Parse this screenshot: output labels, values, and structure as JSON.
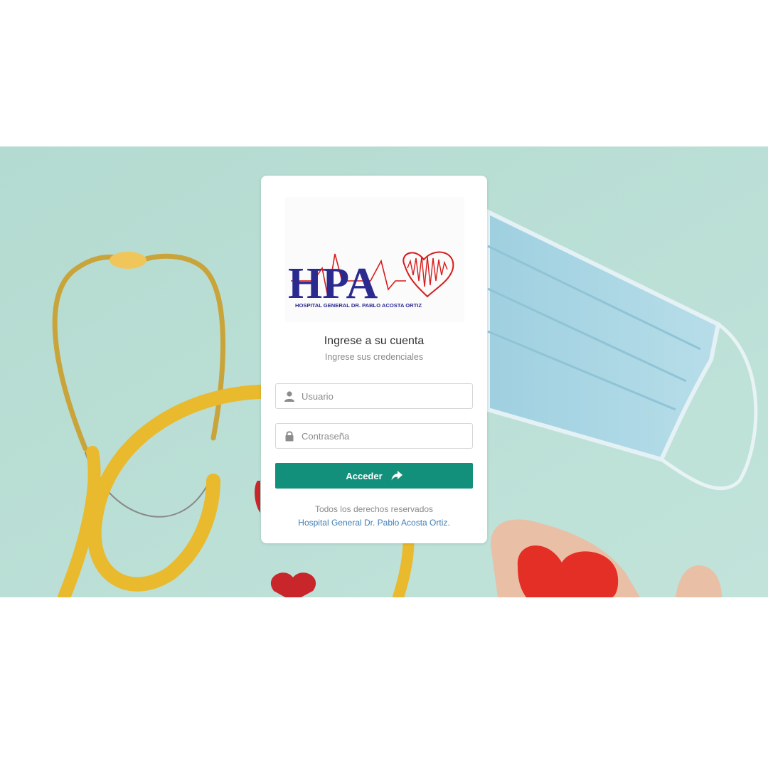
{
  "login": {
    "logo": {
      "letters": "HPA",
      "hospital_name": "HOSPITAL GENERAL DR. PABLO ACOSTA ORTIZ"
    },
    "title": "Ingrese a su cuenta",
    "subtitle": "Ingrese sus credenciales",
    "username": {
      "value": "",
      "placeholder": "Usuario",
      "icon": "user-icon"
    },
    "password": {
      "value": "",
      "placeholder": "Contraseña",
      "icon": "lock-icon"
    },
    "submit": {
      "label": "Acceder",
      "icon": "share-arrow-icon"
    },
    "footer": {
      "rights": "Todos los derechos reservados",
      "link_text": "Hospital General Dr. Pablo Acosta Ortiz."
    }
  },
  "colors": {
    "background_band": "#b7ddd3",
    "button": "#13907b",
    "link": "#3e7fb6",
    "logo_blue": "#2b2a8f",
    "logo_red": "#d81b1b"
  }
}
